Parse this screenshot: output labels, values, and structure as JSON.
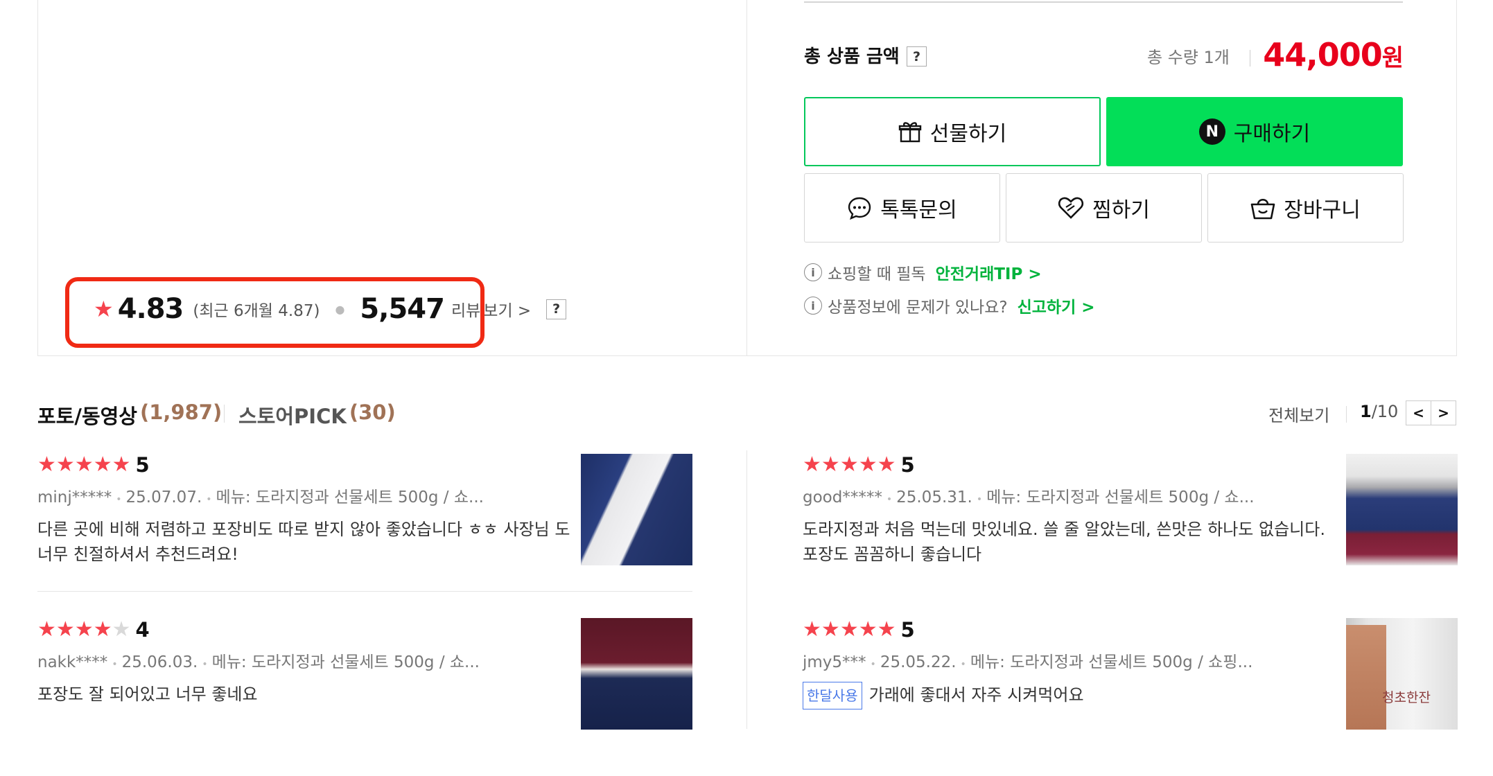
{
  "rating": {
    "score": "4.83",
    "recent": "(최근 6개월 4.87)",
    "count": "5,547",
    "review_label": "리뷰",
    "view_more": "보기 >",
    "help": "?"
  },
  "purchase": {
    "total_label": "총 상품 금액",
    "help": "?",
    "qty_text": "총 수량 1개",
    "price": "44,000",
    "price_unit": "원",
    "gift_label": "선물하기",
    "buy_label": "구매하기",
    "buy_badge": "N",
    "talk_label": "톡톡문의",
    "wish_label": "찜하기",
    "cart_label": "장바구니",
    "info1_text": "쇼핑할 때 필독",
    "info1_link": "안전거래TIP >",
    "info2_text": "상품정보에 문제가 있나요?",
    "info2_link": "신고하기 >",
    "info_icon": "i"
  },
  "reviews_header": {
    "tab1_label": "포토/동영상",
    "tab1_count": "(1,987)",
    "tab2_label": "스토어PICK",
    "tab2_count": "(30)",
    "view_all": "전체보기",
    "page_current": "1",
    "page_total": "/10",
    "prev": "<",
    "next": ">"
  },
  "reviews": [
    {
      "stars": 5,
      "score": "5",
      "user": "minj*****",
      "date": "25.07.07.",
      "menu": "메뉴: 도라지정과 선물세트 500g / 쇼...",
      "tag": "",
      "body": "다른 곳에 비해 저렴하고 포장비도 따로 받지 않아 좋았습니다 ㅎㅎ 사장님 도 너무 친절하셔서 추천드려요!"
    },
    {
      "stars": 5,
      "score": "5",
      "user": "good*****",
      "date": "25.05.31.",
      "menu": "메뉴: 도라지정과 선물세트 500g / 쇼...",
      "tag": "",
      "body": "도라지정과 처음 먹는데 맛있네요. 쓸 줄 알았는데, 쓴맛은 하나도 없습니다. 포장도 꼼꼼하니 좋습니다"
    },
    {
      "stars": 4,
      "score": "4",
      "user": "nakk****",
      "date": "25.06.03.",
      "menu": "메뉴: 도라지정과 선물세트 500g / 쇼...",
      "tag": "",
      "body": "포장도 잘 되어있고 너무 좋네요"
    },
    {
      "stars": 5,
      "score": "5",
      "user": "jmy5***",
      "date": "25.05.22.",
      "menu": "메뉴: 도라지정과 선물세트 500g / 쇼핑...",
      "tag": "한달사용",
      "body": "가래에 좋대서 자주 시켜먹어요"
    }
  ],
  "thumb4_text": "청초한잔",
  "colors": {
    "price": "#e8001c",
    "buy_bg": "#03de58",
    "accent_green": "#00b33c",
    "star": "#f5434d",
    "highlight": "#f02a14",
    "tab_count": "#a07256"
  }
}
